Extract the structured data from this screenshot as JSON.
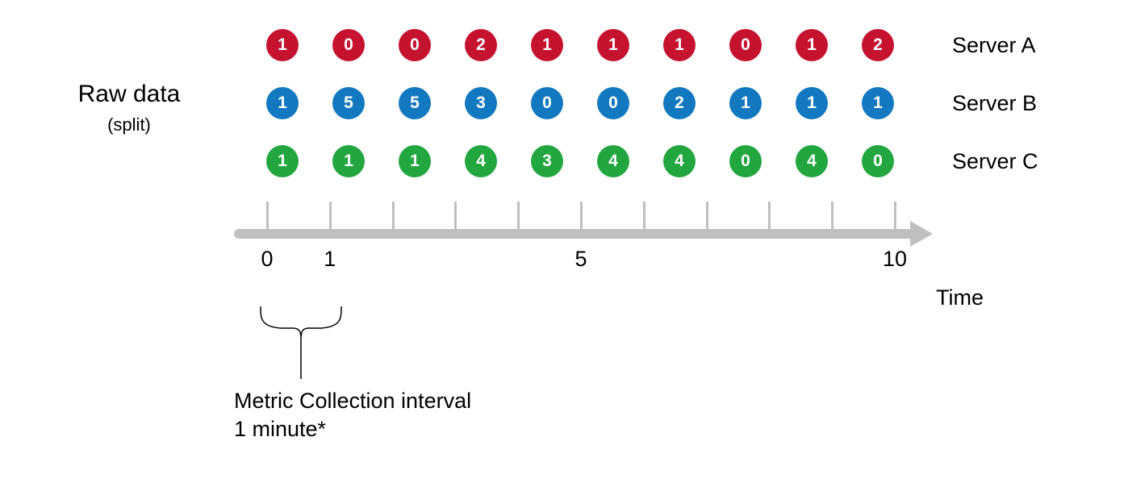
{
  "left": {
    "title": "Raw data",
    "subtitle": "(split)"
  },
  "chart_data": {
    "type": "table",
    "title": "Raw data (split)",
    "xlabel": "Time",
    "x_ticks": [
      "0",
      "1",
      "",
      "",
      "",
      "5",
      "",
      "",
      "",
      "",
      "10"
    ],
    "series": [
      {
        "name": "Server A",
        "color": "#c4122f",
        "values": [
          1,
          0,
          0,
          2,
          1,
          1,
          1,
          0,
          1,
          2
        ]
      },
      {
        "name": "Server B",
        "color": "#1279c0",
        "values": [
          1,
          5,
          5,
          3,
          0,
          0,
          2,
          1,
          1,
          1
        ]
      },
      {
        "name": "Server C",
        "color": "#22a63f",
        "values": [
          1,
          1,
          1,
          4,
          3,
          4,
          4,
          0,
          4,
          0
        ]
      }
    ],
    "annotation": {
      "line1": "Metric Collection interval",
      "line2": "1 minute*"
    }
  },
  "time_label": "Time"
}
